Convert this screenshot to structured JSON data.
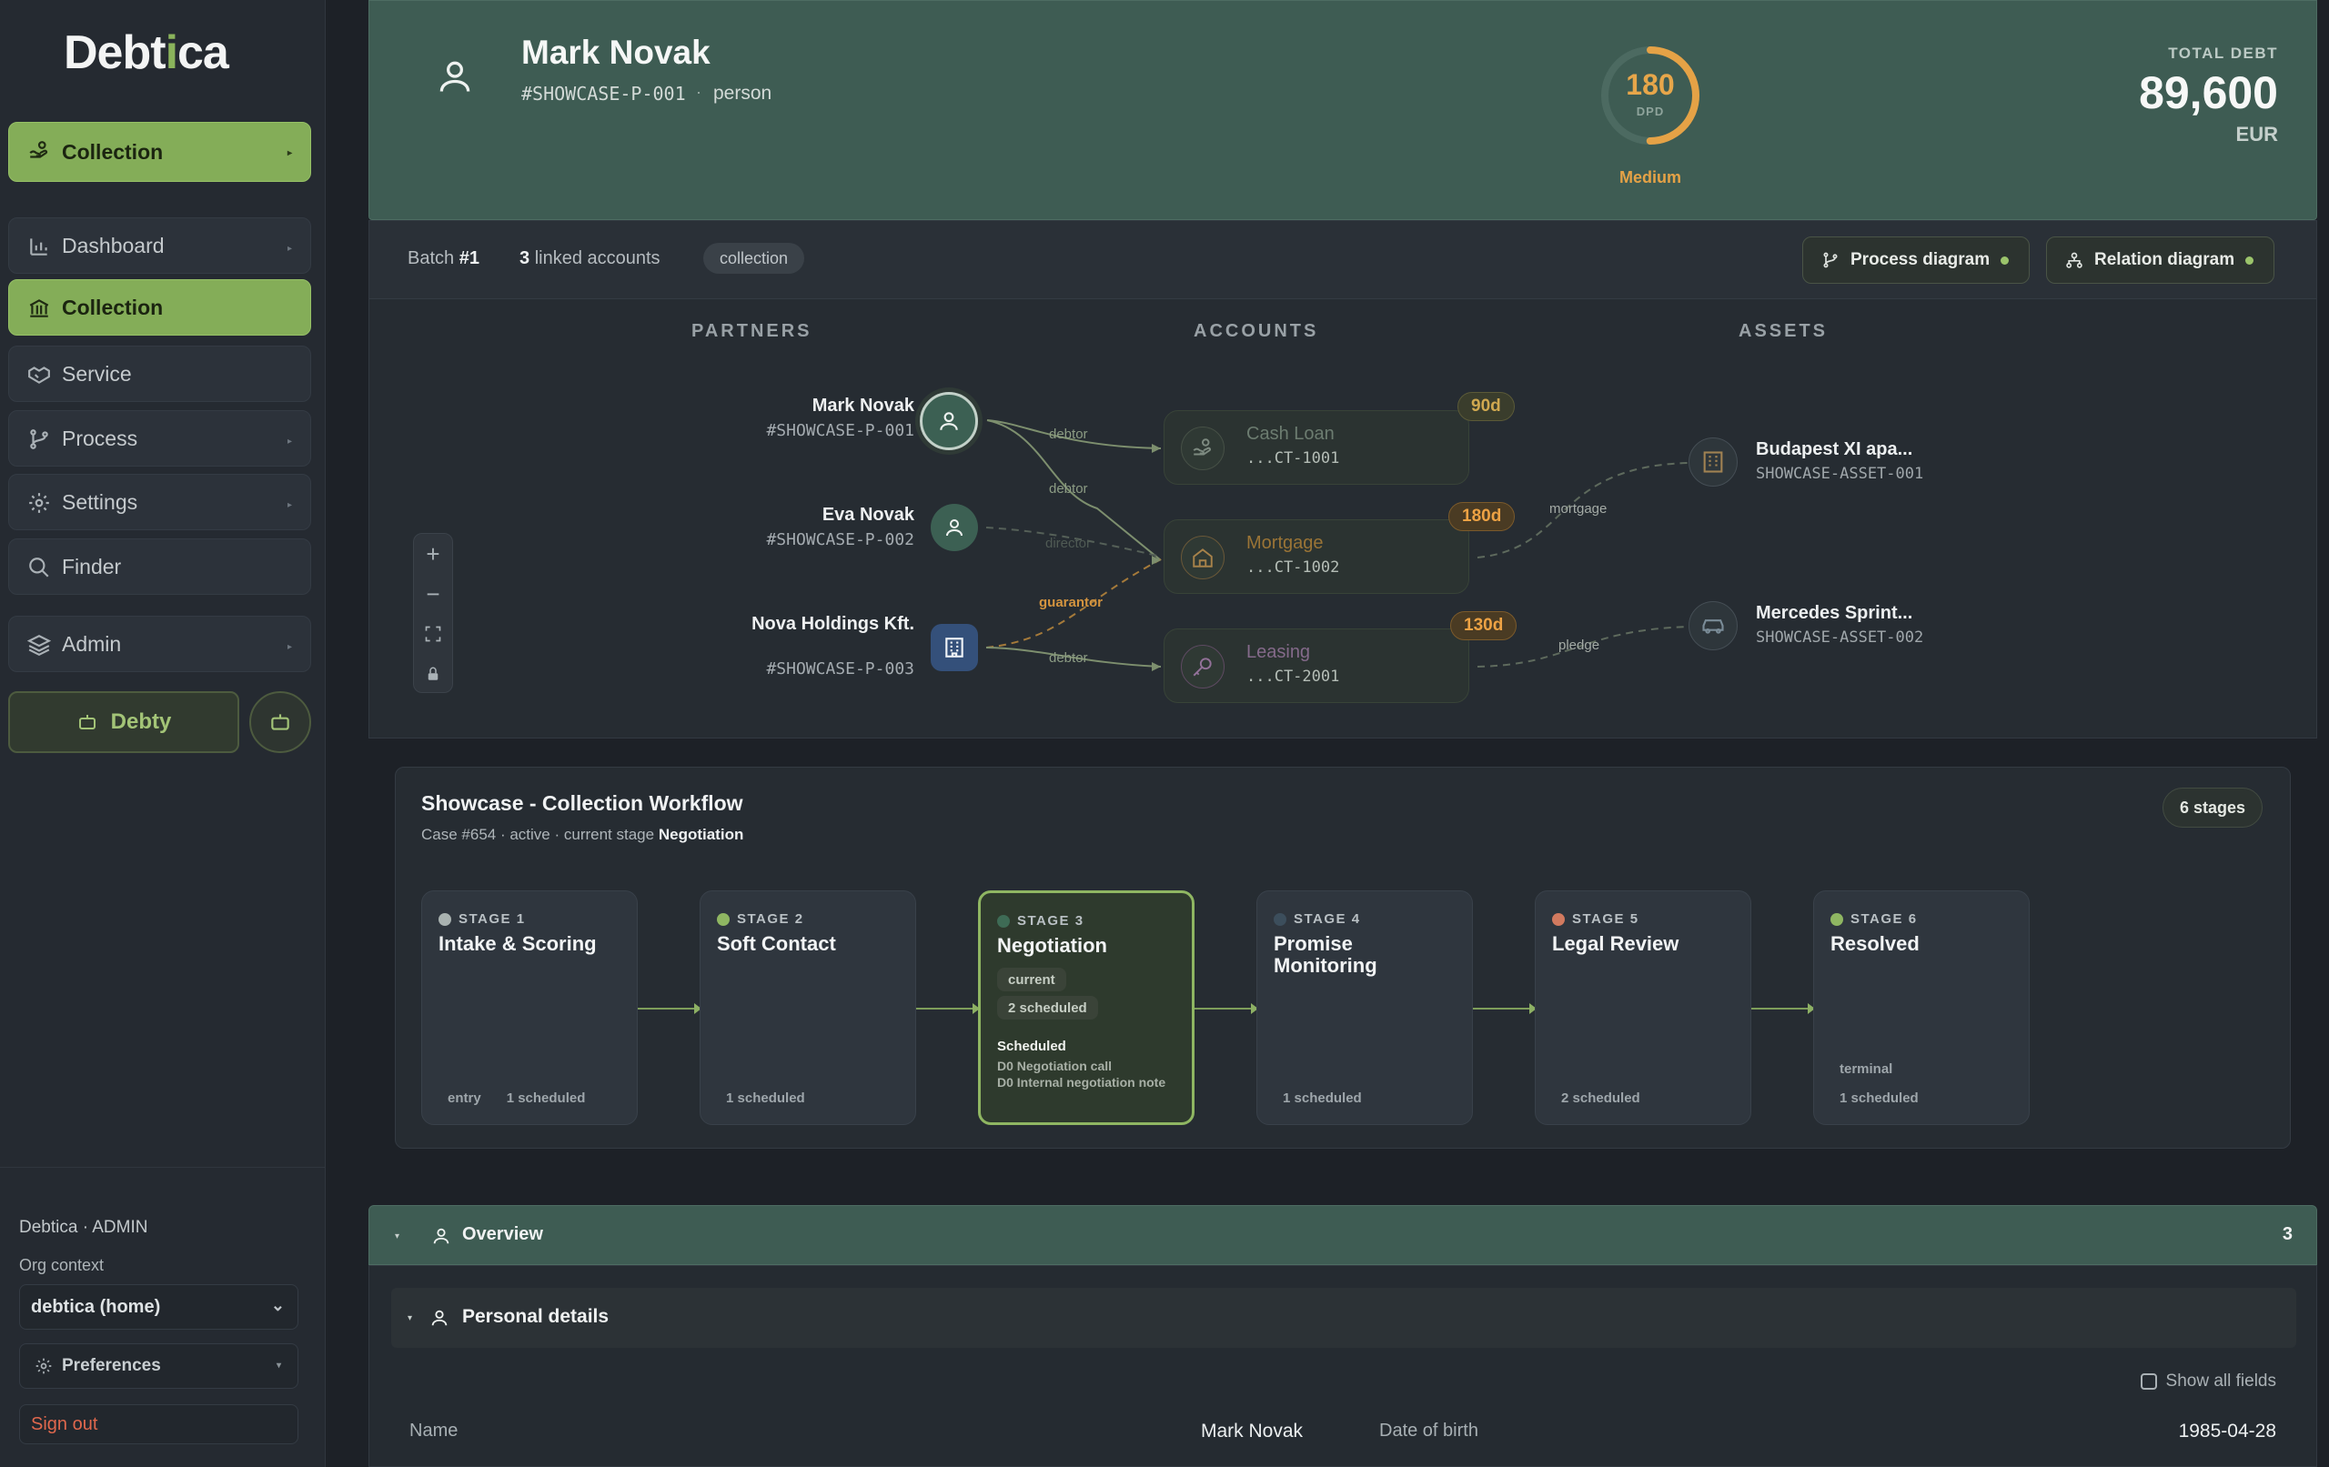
{
  "brand": {
    "name_pre": "Debt",
    "name_i": "i",
    "name_post": "ca"
  },
  "sidebar": {
    "top_item": {
      "label": "Collection",
      "icon": "hand-money-icon"
    },
    "items": [
      {
        "label": "Dashboard",
        "icon": "bar-chart-icon"
      },
      {
        "label": "Collection",
        "icon": "bank-icon"
      },
      {
        "label": "Service",
        "icon": "handshake-icon"
      },
      {
        "label": "Process",
        "icon": "branch-icon"
      },
      {
        "label": "Settings",
        "icon": "gear-icon"
      },
      {
        "label": "Finder",
        "icon": "search-icon"
      },
      {
        "label": "Admin",
        "icon": "layers-icon"
      }
    ],
    "debty_label": "Debty",
    "user_line": "Debtica · ADMIN",
    "org_label": "Org context",
    "org_value": "debtica (home)",
    "preferences_label": "Preferences",
    "signout_label": "Sign out"
  },
  "header": {
    "name": "Mark Novak",
    "id": "#SHOWCASE-P-001",
    "separator": "·",
    "type": "person",
    "dpd_value": "180",
    "dpd_label": "DPD",
    "risk": "Medium",
    "total_debt_label": "TOTAL DEBT",
    "total_debt_value": "89,600",
    "currency": "EUR",
    "dpd_ring_fraction": 0.5
  },
  "toolbar": {
    "batch_label": "Batch",
    "batch_no": "#1",
    "linked_count": "3",
    "linked_label": "linked accounts",
    "tag": "collection",
    "process_btn": "Process diagram",
    "relation_btn": "Relation diagram"
  },
  "relation": {
    "col_partners": "PARTNERS",
    "col_accounts": "ACCOUNTS",
    "col_assets": "ASSETS",
    "partners": [
      {
        "name": "Mark Novak",
        "id": "#SHOWCASE-P-001",
        "icon": "person-icon"
      },
      {
        "name": "Eva Novak",
        "id": "#SHOWCASE-P-002",
        "icon": "person-icon"
      },
      {
        "name": "Nova Holdings Kft.",
        "id": "#SHOWCASE-P-003",
        "icon": "building-icon"
      }
    ],
    "accounts": [
      {
        "name": "Cash Loan",
        "id": "...CT-1001",
        "days": "90d",
        "icon": "hand-money-icon"
      },
      {
        "name": "Mortgage",
        "id": "...CT-1002",
        "days": "180d",
        "icon": "home-icon"
      },
      {
        "name": "Leasing",
        "id": "...CT-2001",
        "days": "130d",
        "icon": "key-icon"
      }
    ],
    "assets": [
      {
        "name": "Budapest XI apa...",
        "id": "SHOWCASE-ASSET-001",
        "icon": "apartment-icon"
      },
      {
        "name": "Mercedes Sprint...",
        "id": "SHOWCASE-ASSET-002",
        "icon": "car-icon"
      }
    ],
    "edges": {
      "debtor_1": "debtor",
      "debtor_2": "debtor",
      "director": "director",
      "guarantor": "guarantor",
      "debtor_3": "debtor",
      "mortgage": "mortgage",
      "pledge": "pledge"
    },
    "zoom": {
      "in": "+",
      "out": "−"
    }
  },
  "workflow": {
    "title": "Showcase - Collection Workflow",
    "case": "Case #654",
    "status": "active",
    "stage_prefix": "current stage",
    "current_stage": "Negotiation",
    "stages_badge": "6 stages",
    "stages": [
      {
        "label": "STAGE 1",
        "name": "Intake & Scoring",
        "dot": "#a9b2b0",
        "foot1": "entry",
        "foot2": "1 scheduled"
      },
      {
        "label": "STAGE 2",
        "name": "Soft Contact",
        "dot": "#8fb662",
        "foot1": "",
        "foot2": "1 scheduled"
      },
      {
        "label": "STAGE 3",
        "name": "Negotiation",
        "dot": "#3e6b55",
        "chip1": "current",
        "chip2": "2 scheduled",
        "sched_title": "Scheduled",
        "sched_1": "D0 Negotiation call",
        "sched_2": "D0 Internal negotiation note"
      },
      {
        "label": "STAGE 4",
        "name": "Promise Monitoring",
        "dot": "#3c4e5c",
        "foot1": "",
        "foot2": "1 scheduled"
      },
      {
        "label": "STAGE 5",
        "name": "Legal Review",
        "dot": "#d27a5f",
        "foot1": "",
        "foot2": "2 scheduled"
      },
      {
        "label": "STAGE 6",
        "name": "Resolved",
        "dot": "#8fb662",
        "foot1": "terminal",
        "foot2": "1 scheduled"
      }
    ]
  },
  "overview": {
    "title": "Overview",
    "count": "3",
    "personal_title": "Personal details",
    "show_all": "Show all fields",
    "name_label": "Name",
    "name_value": "Mark Novak",
    "dob_label": "Date of birth",
    "dob_value": "1985-04-28"
  },
  "colors": {
    "accent": "#84ad58",
    "header_bg": "#3e5c53",
    "warning": "#e5a246"
  }
}
